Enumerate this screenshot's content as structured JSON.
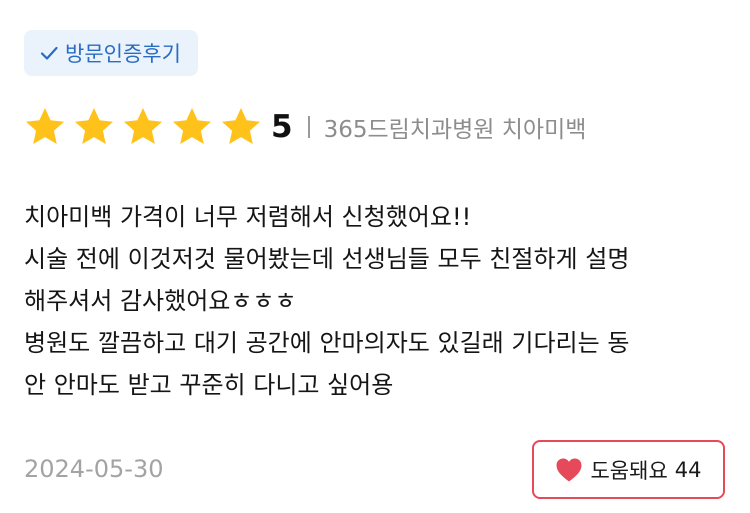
{
  "badge": {
    "icon": "check-icon",
    "label": "방문인증후기",
    "color": "#2a6cc4"
  },
  "rating": {
    "stars": 5,
    "max_stars": 5,
    "star_icon": "star-icon",
    "star_color": "#ffc21a",
    "score": "5",
    "clinic": "365드림치과병원 치아미백"
  },
  "review": {
    "lines": [
      "치아미백 가격이 너무 저렴해서 신청했어요!!",
      "시술 전에 이것저것 물어봤는데 선생님들 모두 친절하게 설명",
      "해주셔서 감사했어요ㅎㅎㅎ",
      "병원도 깔끔하고 대기 공간에 안마의자도 있길래 기다리는 동",
      "안 안마도 받고 꾸준히 다니고 싶어용"
    ]
  },
  "date": "2024-05-30",
  "helpful": {
    "icon": "heart-icon",
    "label": "도움돼요",
    "count": "44",
    "color": "#e64a5a"
  }
}
